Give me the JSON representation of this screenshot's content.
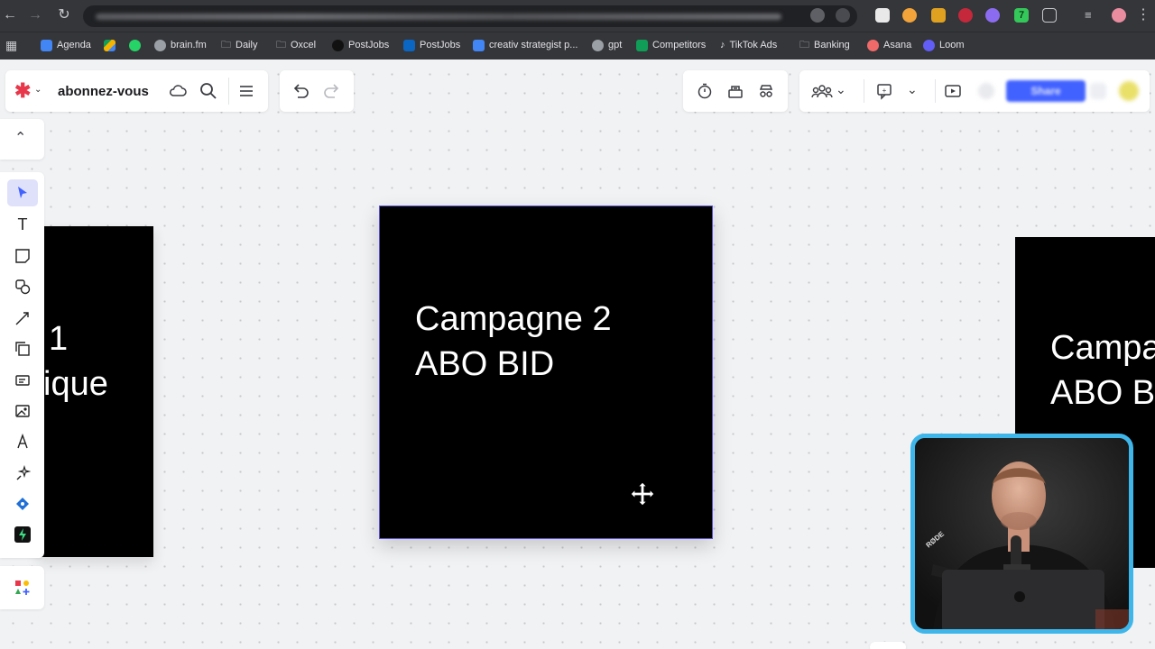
{
  "browser": {
    "bookmarks": [
      {
        "label": "Agenda",
        "color": "#4285f4"
      },
      {
        "label": "",
        "color": "#0f9d58"
      },
      {
        "label": "",
        "color": "#25d366"
      },
      {
        "label": "brain.fm",
        "color": "#9aa0a6"
      },
      {
        "label": "Daily",
        "color": "#9aa0a6"
      },
      {
        "label": "Oxcel",
        "color": "#9aa0a6"
      },
      {
        "label": "PostJobs",
        "color": "#111111"
      },
      {
        "label": "PostJobs",
        "color": "#0a66c2"
      },
      {
        "label": "creativ strategist p...",
        "color": "#4285f4"
      },
      {
        "label": "gpt",
        "color": "#9aa0a6"
      },
      {
        "label": "Competitors",
        "color": "#0f9d58"
      },
      {
        "label": "TikTok Ads",
        "color": "#9aa0a6"
      },
      {
        "label": "Banking",
        "color": "#9aa0a6"
      },
      {
        "label": "Asana",
        "color": "#f06a6a"
      },
      {
        "label": "Loom",
        "color": "#625df5"
      }
    ]
  },
  "header": {
    "board_title": "abonnez-vous",
    "share_label": "Share"
  },
  "canvas": {
    "frames": [
      {
        "line1": "1",
        "line2": "ique"
      },
      {
        "line1": "Campagne 2",
        "line2": "ABO BID"
      },
      {
        "line1": "Campa",
        "line2": "ABO B"
      }
    ]
  },
  "colors": {
    "accent": "#4262ff",
    "logo_red": "#e8374a",
    "webcam_border": "#3fb6ea"
  }
}
